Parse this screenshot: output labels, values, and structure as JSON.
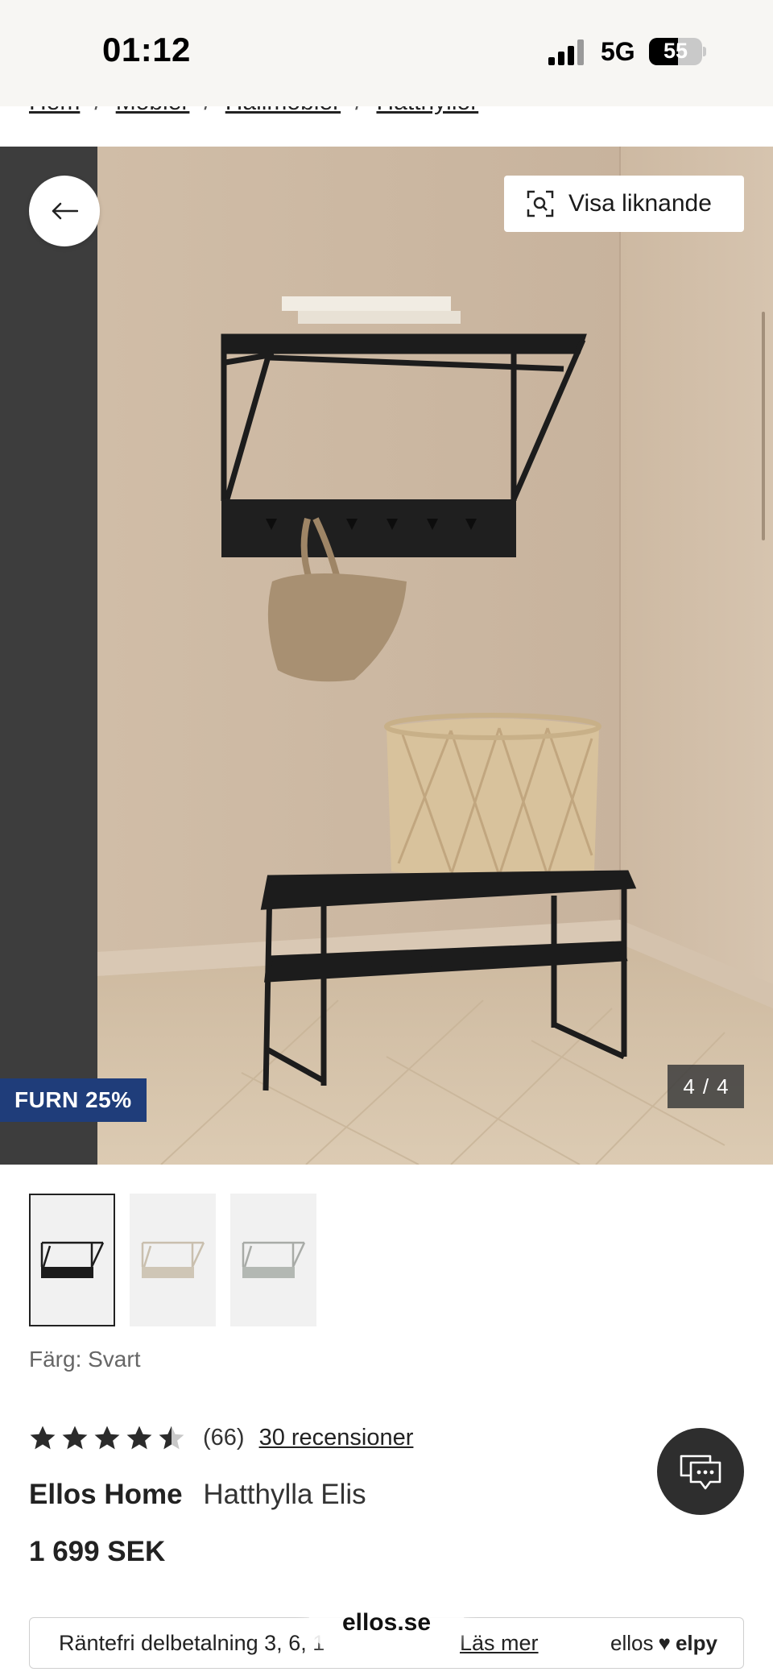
{
  "status_bar": {
    "time": "01:12",
    "network": "5G",
    "battery": "55",
    "battery_level": 0.55
  },
  "breadcrumb": {
    "items": [
      "Hem",
      "Möbler",
      "Hallmöbler",
      "Hatthyllor"
    ]
  },
  "hero": {
    "back_icon": "arrow-left-icon",
    "similar_label": "Visa liknande",
    "similar_icon": "visual-search-icon",
    "promo_badge": "FURN 25%",
    "counter_current": "4",
    "counter_sep": "/",
    "counter_total": "4",
    "colors": {
      "wall": "#cdb9a3",
      "dark_strip": "#3d3d3d",
      "floor": "#d6c4ab",
      "metal": "#1c1c1c"
    }
  },
  "thumbnails": [
    {
      "variant": "black",
      "selected": true
    },
    {
      "variant": "beige",
      "selected": false
    },
    {
      "variant": "grey",
      "selected": false
    }
  ],
  "product": {
    "color_label": "Färg: Svart",
    "rating": 4.5,
    "rating_count": "(66)",
    "reviews_link": "30 recensioner",
    "brand": "Ellos Home",
    "name": "Hatthylla Elis",
    "price": "1 699 SEK"
  },
  "chat": {
    "icon": "chat-bubble-icon"
  },
  "finance": {
    "text": "Räntefri delbetalning 3, 6, 1",
    "link": "Läs mer",
    "logo_left": "ellos",
    "logo_heart": "♥",
    "logo_right": "elpy"
  },
  "browser": {
    "url": "ellos.se"
  },
  "accent_colors": {
    "promo": "#1f3d7a",
    "text": "#222222"
  }
}
